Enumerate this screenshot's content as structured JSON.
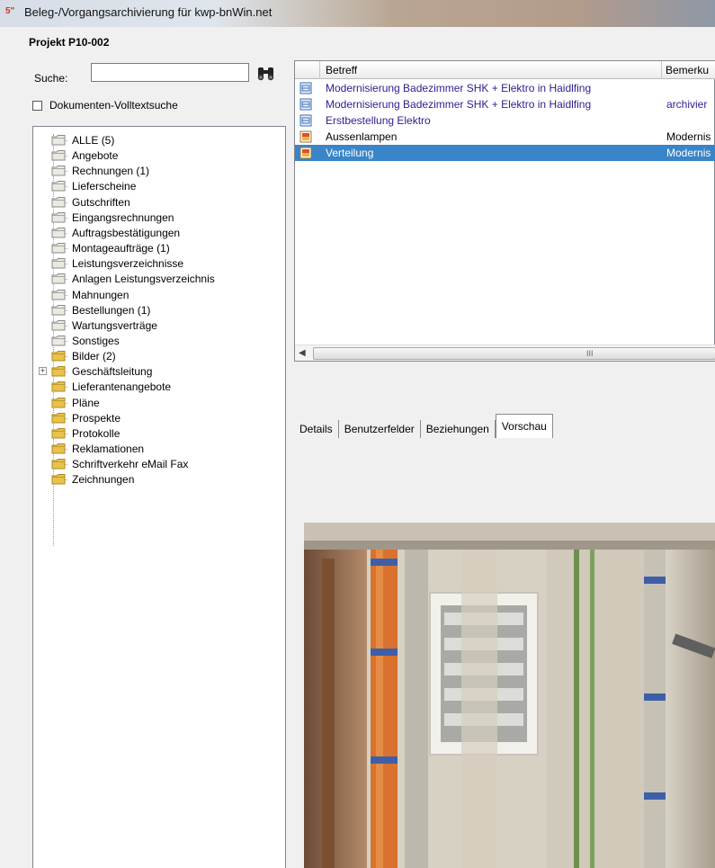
{
  "window": {
    "title": "Beleg-/Vorgangsarchivierung für kwp-bnWin.net",
    "icon_text": "5\""
  },
  "project": {
    "title": "Projekt P10-002"
  },
  "search": {
    "label": "Suche:",
    "value": "",
    "placeholder": ""
  },
  "fulltext": {
    "label": "Dokumenten-Volltextsuche",
    "checked": false
  },
  "tree": {
    "items": [
      {
        "label": "ALLE (5)",
        "open": true
      },
      {
        "label": "Angebote"
      },
      {
        "label": "Rechnungen (1)"
      },
      {
        "label": "Lieferscheine"
      },
      {
        "label": "Gutschriften"
      },
      {
        "label": "Eingangsrechnungen"
      },
      {
        "label": "Auftragsbestätigungen"
      },
      {
        "label": "Montageaufträge (1)"
      },
      {
        "label": "Leistungsverzeichnisse"
      },
      {
        "label": "Anlagen Leistungsverzeichnis"
      },
      {
        "label": "Mahnungen"
      },
      {
        "label": "Bestellungen (1)"
      },
      {
        "label": "Wartungsverträge"
      },
      {
        "label": "Sonstiges"
      },
      {
        "label": "Bilder (2)",
        "yellow": true
      },
      {
        "label": "Geschäftsleitung",
        "yellow": true,
        "expandable": true
      },
      {
        "label": "Lieferantenangebote",
        "yellow": true
      },
      {
        "label": "Pläne",
        "yellow": true
      },
      {
        "label": "Prospekte",
        "yellow": true
      },
      {
        "label": "Protokolle",
        "yellow": true
      },
      {
        "label": "Reklamationen",
        "yellow": true
      },
      {
        "label": "Schriftverkehr eMail Fax",
        "yellow": true
      },
      {
        "label": "Zeichnungen",
        "yellow": true
      }
    ]
  },
  "list": {
    "columns": [
      "Betreff",
      "Bemerku"
    ],
    "rows": [
      {
        "betreff": "Modernisierung Badezimmer SHK + Elektro in Haidlfing",
        "bemerkung": "",
        "icon": "document-blue-icon",
        "color": "blue"
      },
      {
        "betreff": "Modernisierung Badezimmer SHK + Elektro in Haidlfing",
        "bemerkung": "archivier",
        "icon": "document-blue-icon",
        "color": "blue"
      },
      {
        "betreff": "Erstbestellung Elektro",
        "bemerkung": "",
        "icon": "document-blue-icon",
        "color": "blue"
      },
      {
        "betreff": "Aussenlampen",
        "bemerkung": "Modernis",
        "icon": "image-file-icon",
        "color": "black"
      },
      {
        "betreff": "Verteilung",
        "bemerkung": "Modernis",
        "icon": "image-file-icon",
        "color": "black",
        "selected": true
      }
    ],
    "scroll_grip": "III"
  },
  "tabs": [
    {
      "label": "Details"
    },
    {
      "label": "Benutzerfelder"
    },
    {
      "label": "Beziehungen"
    },
    {
      "label": "Vorschau",
      "active": true
    }
  ],
  "preview": {
    "subject": "electrical-distribution-cabinet-photo"
  }
}
